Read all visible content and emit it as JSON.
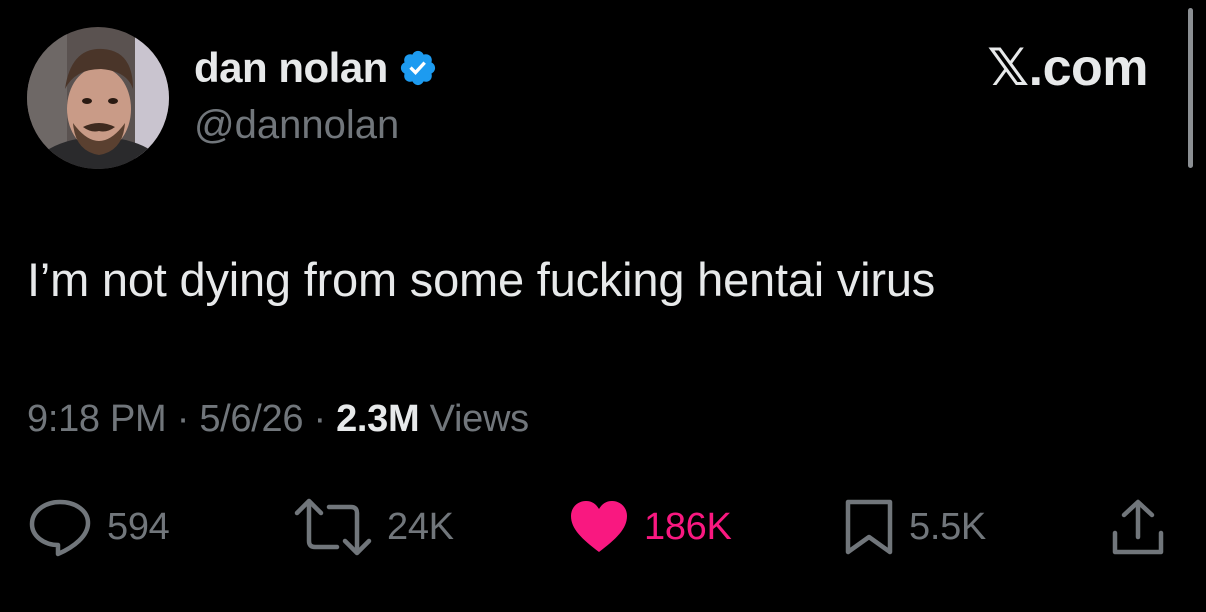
{
  "author": {
    "display_name": "dan nolan",
    "handle": "@dannolan",
    "verified": true,
    "avatar_icon": "avatar-photo"
  },
  "brand": {
    "label": "𝕏.com"
  },
  "tweet": {
    "text": "I’m not dying from some fucking hentai virus",
    "time": "9:18 PM",
    "date": "5/6/26",
    "separator": "·",
    "views_count": "2.3M",
    "views_label": "Views"
  },
  "actions": {
    "reply": {
      "icon": "reply-icon",
      "count": "594"
    },
    "repost": {
      "icon": "repost-icon",
      "count": "24K"
    },
    "like": {
      "icon": "heart-icon",
      "count": "186K",
      "active": true
    },
    "bookmark": {
      "icon": "bookmark-icon",
      "count": "5.5K"
    },
    "share": {
      "icon": "share-icon"
    }
  },
  "colors": {
    "background": "#000000",
    "primary_text": "#e7e9ea",
    "secondary_text": "#71767b",
    "verified_blue": "#1d9bf0",
    "like_pink": "#f91880"
  }
}
